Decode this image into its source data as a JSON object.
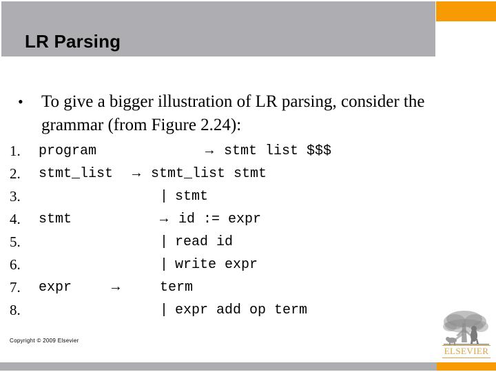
{
  "slide": {
    "title": "LR Parsing",
    "colors": {
      "header_gray": "#aeaeb2",
      "accent_orange": "#f89a04",
      "text_black": "#000000",
      "logo_gold": "#d9a441"
    }
  },
  "bullets": [
    {
      "marker": "•",
      "text": "To give a bigger illustration of LR parsing, consider the grammar (from Figure 2.24):"
    }
  ],
  "grammar": {
    "arrow": "→",
    "bar": "|",
    "rules": [
      {
        "num": "1.",
        "lhs": "program",
        "arrow": "→",
        "rhs": "stmt list $$$"
      },
      {
        "num": "2.",
        "lhs": "stmt_list",
        "arrow": "→",
        "rhs": "stmt_list stmt"
      },
      {
        "num": "3.",
        "lhs": "",
        "arrow": "|",
        "rhs": "stmt"
      },
      {
        "num": "4.",
        "lhs": "stmt",
        "arrow": "→",
        "rhs": "id := expr"
      },
      {
        "num": "5.",
        "lhs": "",
        "arrow": "|",
        "rhs": "read id"
      },
      {
        "num": "6.",
        "lhs": "",
        "arrow": "|",
        "rhs": "write expr"
      },
      {
        "num": "7.",
        "lhs": "expr",
        "arrow": "→",
        "rhs": "term"
      },
      {
        "num": "8.",
        "lhs": "",
        "arrow": "|",
        "rhs": "expr add op term"
      }
    ]
  },
  "footer": {
    "copyright": "Copyright © 2009 Elsevier",
    "logo_word": "ELSEVIER"
  }
}
